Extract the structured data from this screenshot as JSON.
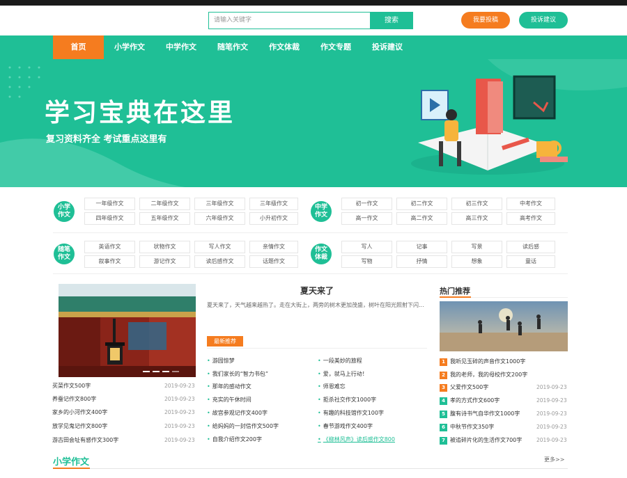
{
  "search": {
    "placeholder": "请输入关键字",
    "button": "搜索"
  },
  "header_buttons": {
    "submit": "我要投稿",
    "feedback": "投诉建议"
  },
  "nav": [
    "首页",
    "小学作文",
    "中学作文",
    "随笔作文",
    "作文体裁",
    "作文专题",
    "投诉建议"
  ],
  "banner": {
    "title": "学习宝典在这里",
    "subtitle": "复习资料齐全 考试重点这里有"
  },
  "categories": {
    "primary": {
      "badge": [
        "小学",
        "作文"
      ],
      "items": [
        "一年级作文",
        "二年级作文",
        "三年级作文",
        "三年级作文",
        "四年级作文",
        "五年级作文",
        "六年级作文",
        "小升初作文"
      ]
    },
    "middle": {
      "badge": [
        "中学",
        "作文"
      ],
      "items": [
        "初一作文",
        "初二作文",
        "初三作文",
        "中考作文",
        "高一作文",
        "高二作文",
        "高三作文",
        "高考作文"
      ]
    },
    "essay": {
      "badge": [
        "随笔",
        "作文"
      ],
      "items": [
        "英语作文",
        "状物作文",
        "写人作文",
        "亲情作文",
        "叙事作文",
        "游记作文",
        "读后感作文",
        "话题作文"
      ]
    },
    "genre": {
      "badge": [
        "作文",
        "体裁"
      ],
      "items": [
        "写人",
        "记事",
        "写景",
        "读后感",
        "写物",
        "抒情",
        "想象",
        "童话"
      ]
    }
  },
  "left_list": [
    {
      "title": "买菜作文500字",
      "date": "2019-09-23"
    },
    {
      "title": "养蚕记作文800字",
      "date": "2019-09-23"
    },
    {
      "title": "家乡的小河作文400字",
      "date": "2019-09-23"
    },
    {
      "title": "放学见鬼记作文800字",
      "date": "2019-09-23"
    },
    {
      "title": "游古田会址有感作文300字",
      "date": "2019-09-23"
    }
  ],
  "feature": {
    "title": "夏天来了",
    "summary": "夏天来了，天气越来越热了。走在大街上，两旁的树木更加茂盛，树叶在阳光照射下闪...",
    "tag": "最新推荐"
  },
  "center_list_left": [
    "游园惊梦",
    "我们家长的“智力书包”",
    "那年的感动作文",
    "充实的午休时间",
    "故宫参观记作文400字",
    "给妈妈的一封信作文500字",
    "自我介绍作文200字"
  ],
  "center_list_right": [
    "一段美妙的旅程",
    "爱，就马上行动！",
    "师恩难忘",
    "拒杀社交作文1000字",
    "有趣的科技馆作文100字",
    "春节游戏作文400字",
    "《柳林风声》读后感作文800"
  ],
  "hot": {
    "title": "热门推荐",
    "items": [
      {
        "rank": "1",
        "title": "我听见玉碎的声音作文1000字",
        "date": ""
      },
      {
        "rank": "2",
        "title": "我的老师，我的母校作文200字",
        "date": ""
      },
      {
        "rank": "3",
        "title": "父爱作文500字",
        "date": "2019-09-23"
      },
      {
        "rank": "4",
        "title": "孝的方式作文600字",
        "date": "2019-09-23"
      },
      {
        "rank": "5",
        "title": "腹有诗书气自华作文1000字",
        "date": "2019-09-23"
      },
      {
        "rank": "6",
        "title": "中秋节作文350字",
        "date": "2019-09-23"
      },
      {
        "rank": "7",
        "title": "被追碎片化的生活作文700字",
        "date": "2019-09-23"
      }
    ]
  },
  "section": {
    "title": "小学作文",
    "more": "更多>>"
  },
  "colors": {
    "primary": "#1fbf96",
    "accent": "#f57c1f",
    "rank_top": "#f57c1f",
    "rank_rest": "#1fbf96"
  }
}
